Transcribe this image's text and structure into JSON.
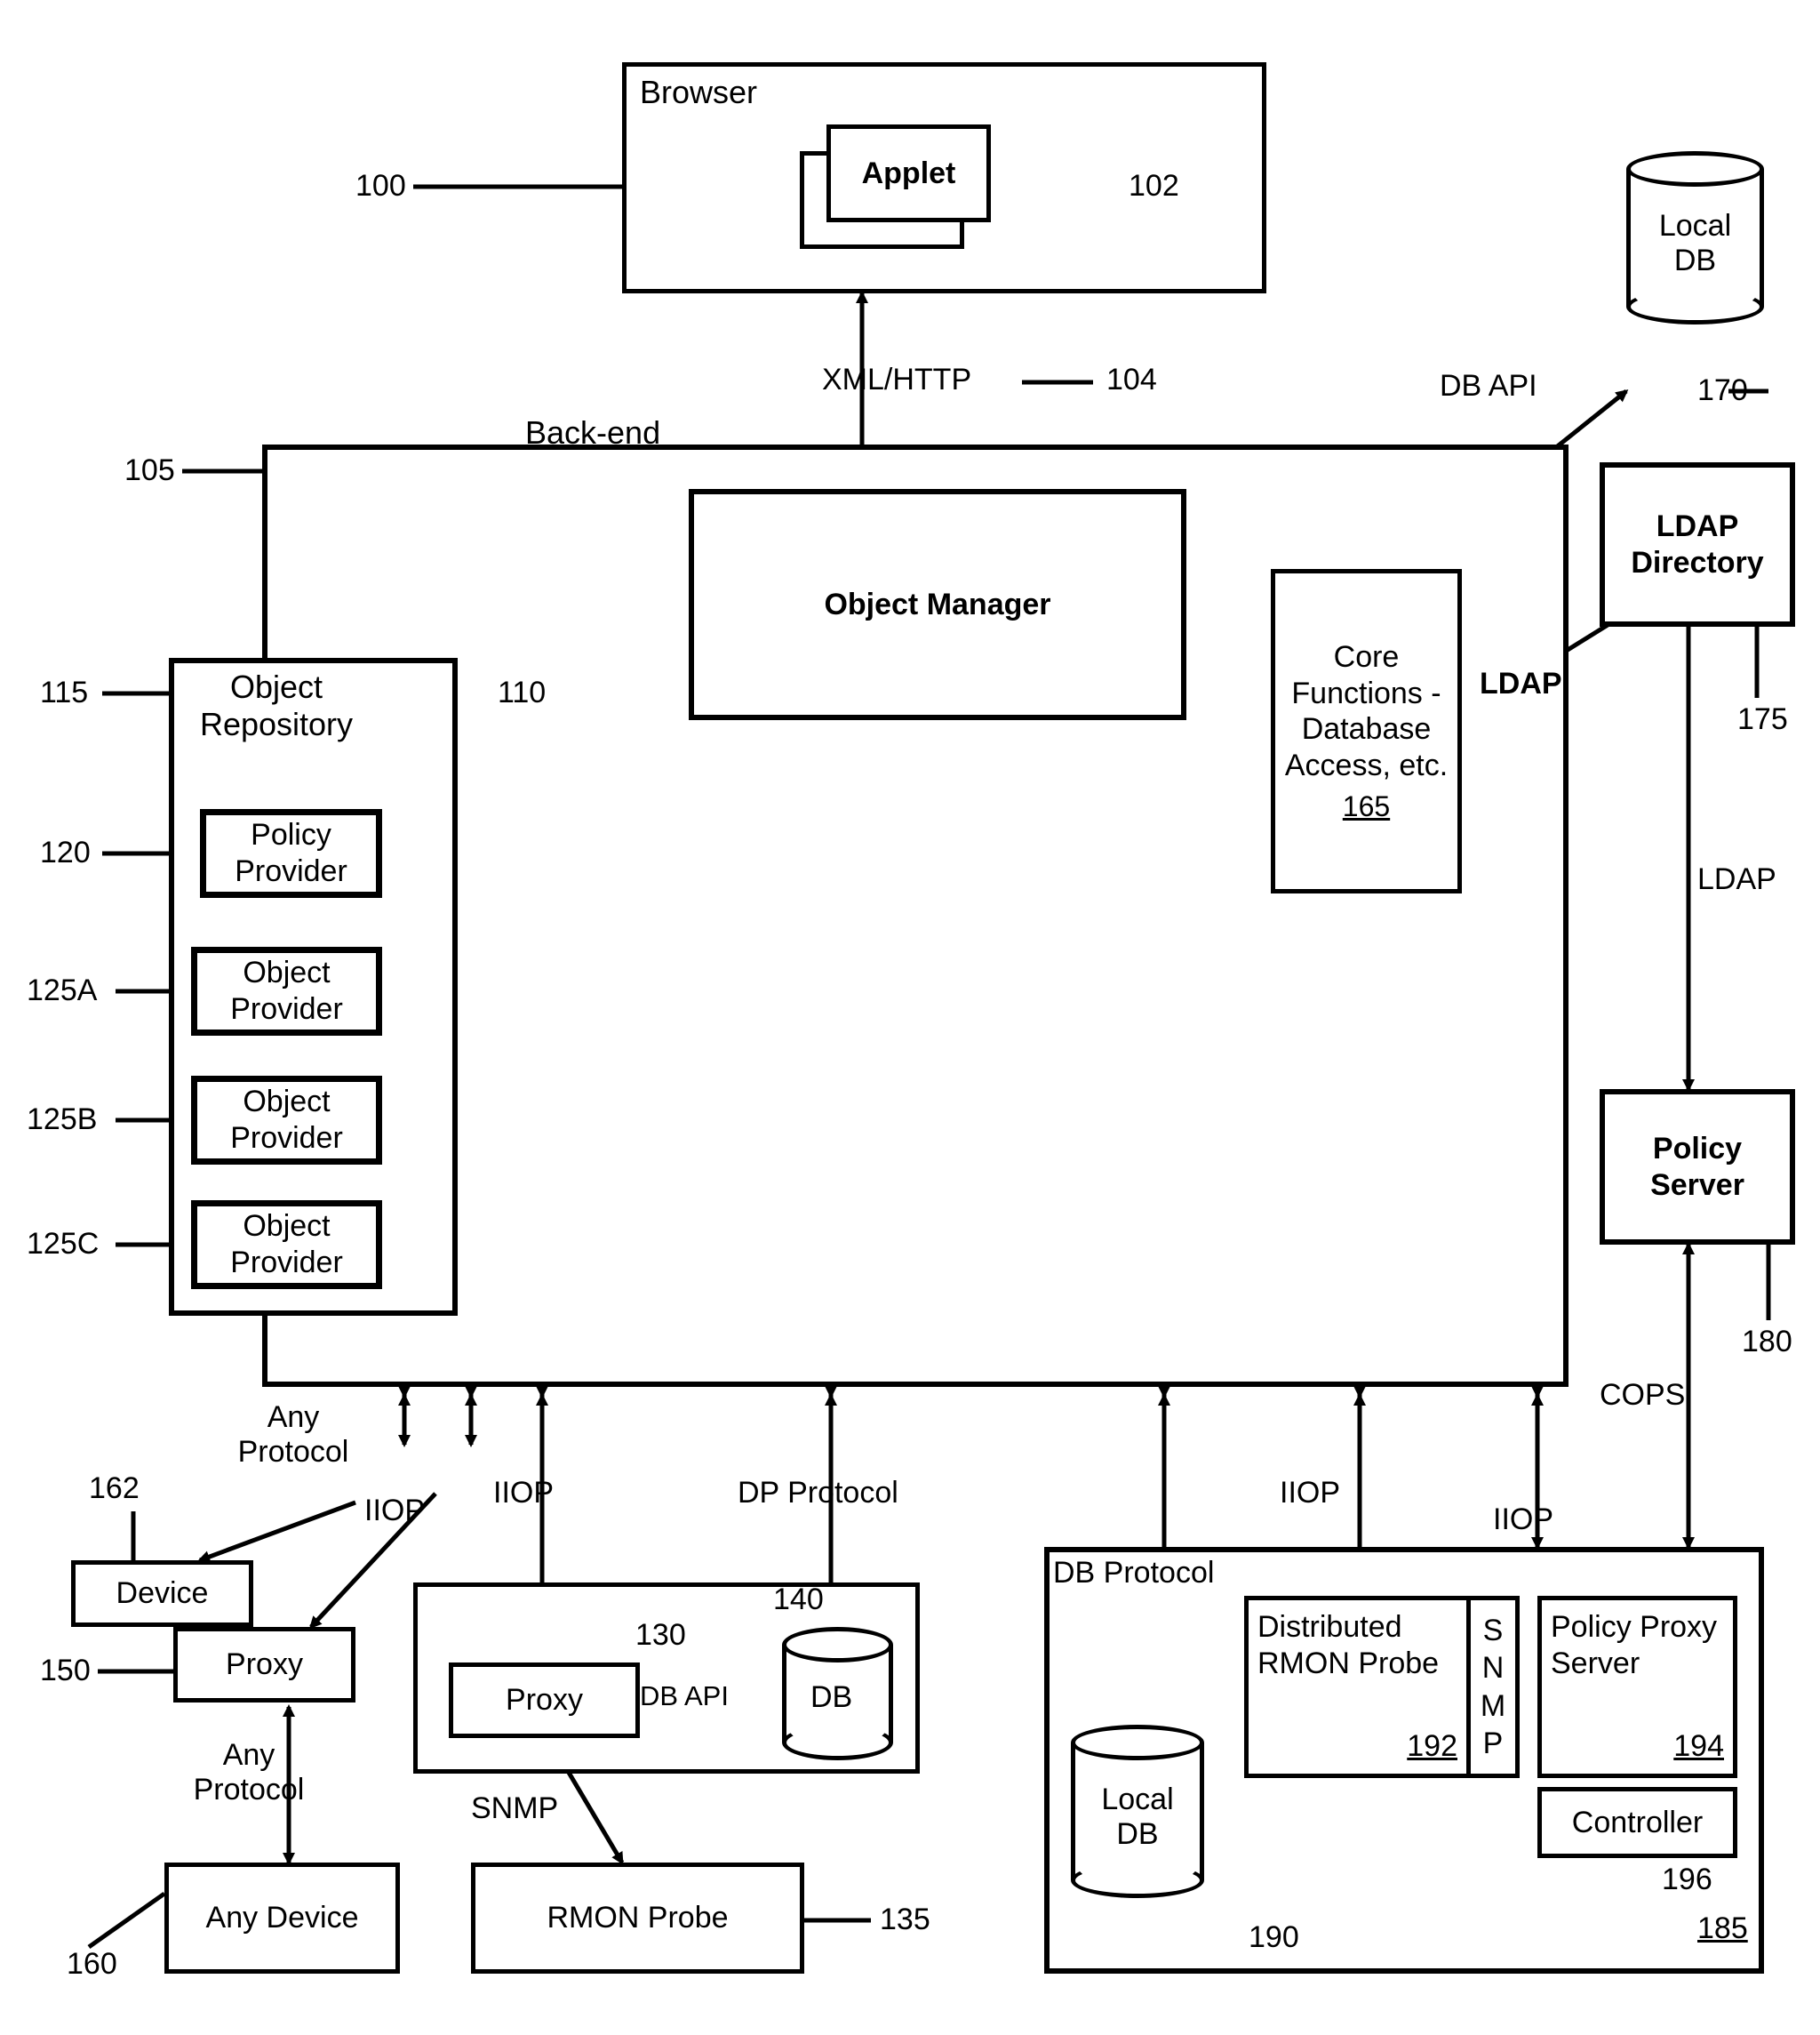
{
  "browser": {
    "title": "Browser",
    "applet": "Applet"
  },
  "refs": {
    "r100": "100",
    "r102": "102",
    "r104": "104",
    "r105": "105",
    "r110": "110",
    "r115": "115",
    "r120": "120",
    "r125A": "125A",
    "r125B": "125B",
    "r125C": "125C",
    "r130": "130",
    "r135": "135",
    "r140": "140",
    "r150": "150",
    "r160": "160",
    "r162": "162",
    "r165": "165",
    "r170": "170",
    "r175": "175",
    "r180": "180",
    "r185": "185",
    "r190": "190",
    "r192": "192",
    "r194": "194",
    "r196": "196"
  },
  "backend": {
    "title": "Back-end",
    "object_manager": "Object Manager",
    "object_repository": "Object Repository",
    "policy_provider": "Policy Provider",
    "object_provider_a": "Object Provider",
    "object_provider_b": "Object Provider",
    "object_provider_c": "Object Provider",
    "core_functions": "Core Functions - Database Access, etc."
  },
  "edges": {
    "xml_http": "XML/HTTP",
    "db_api": "DB API",
    "ldap_lbl": "LDAP",
    "ldap2": "LDAP",
    "cops": "COPS",
    "any_protocol": "Any Protocol",
    "any_protocol2": "Any Protocol",
    "iiop1": "IIOP",
    "iiop2": "IIOP",
    "iiop3": "IIOP",
    "iiop4": "IIOP",
    "dp_protocol": "DP Protocol",
    "db_protocol": "DB Protocol",
    "snmp": "SNMP",
    "snmp_v": "S\nN\nM\nP",
    "db_api2": "DB API"
  },
  "nodes": {
    "local_db": "Local DB",
    "ldap_dir": "LDAP Directory",
    "policy_server": "Policy Server",
    "device": "Device",
    "proxy": "Proxy",
    "proxy2": "Proxy",
    "any_device": "Any Device",
    "rmon_probe": "RMON Probe",
    "db": "DB",
    "local_db2": "Local DB",
    "dist_rmon": "Distributed RMON Probe",
    "policy_proxy_server": "Policy Proxy Server",
    "controller": "Controller"
  }
}
